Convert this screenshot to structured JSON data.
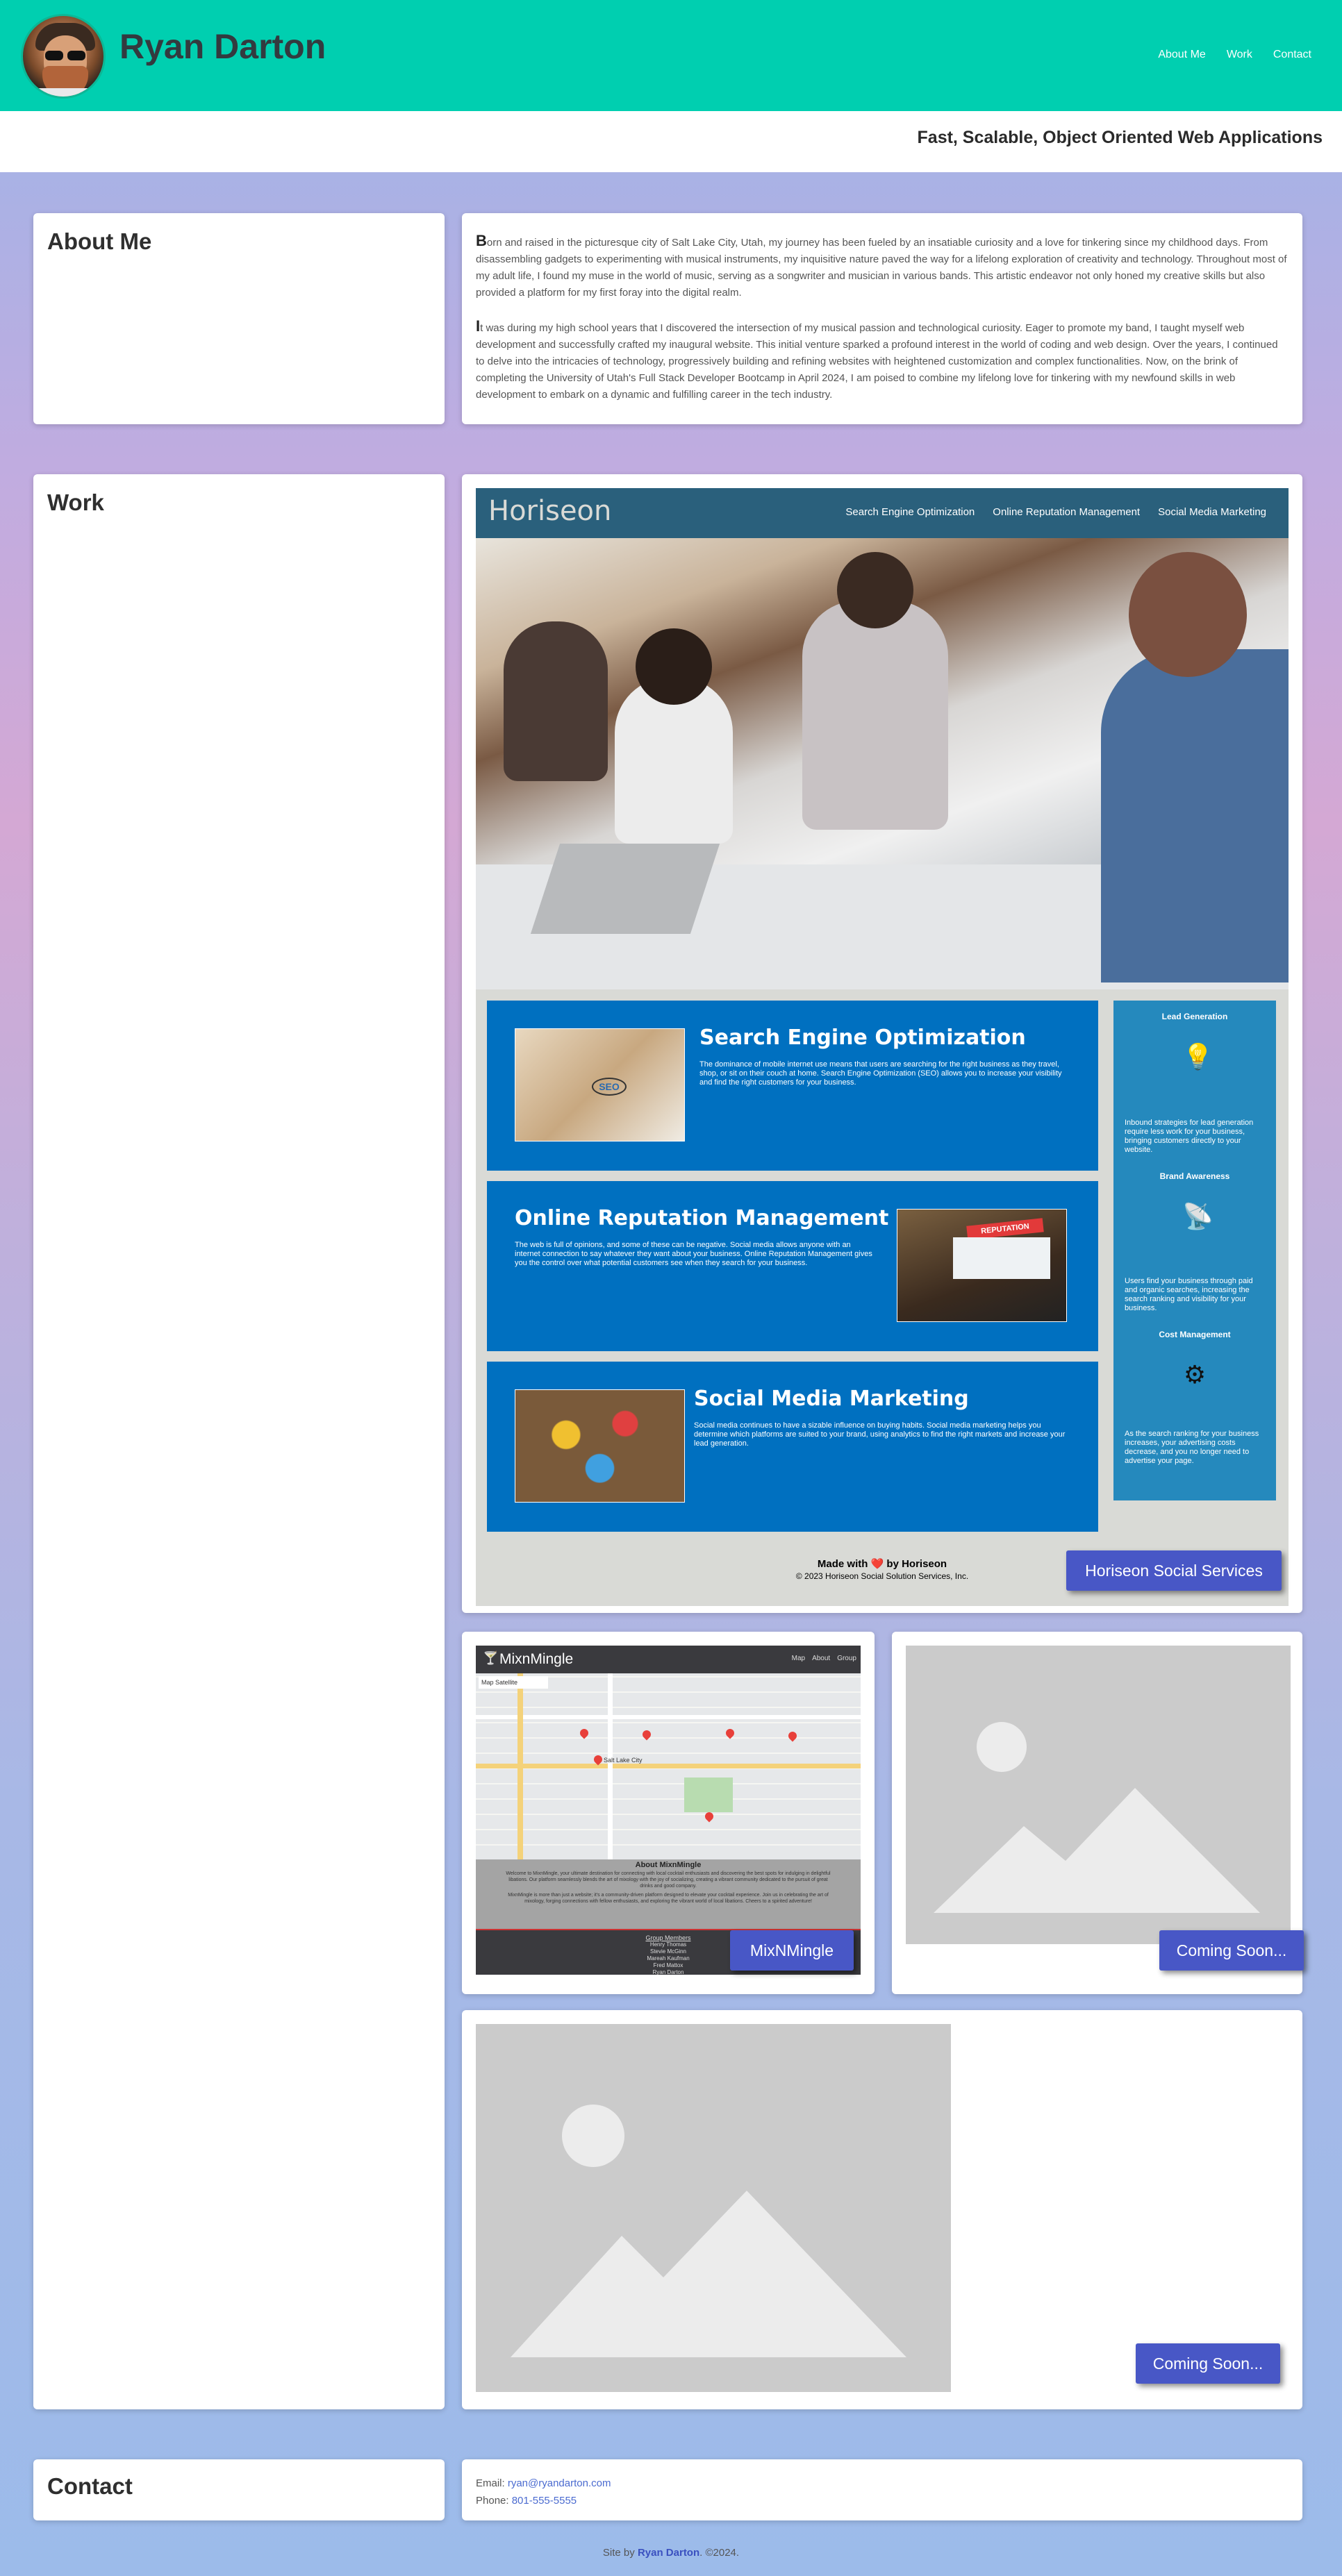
{
  "header": {
    "title": "Ryan Darton",
    "nav": [
      "About Me",
      "Work",
      "Contact"
    ],
    "tagline": "Fast, Scalable, Object Oriented Web Applications"
  },
  "about": {
    "title": "About Me",
    "paragraphs": [
      "Born and raised in the picturesque city of Salt Lake City, Utah, my journey has been fueled by an insatiable curiosity and a love for tinkering since my childhood days. From disassembling gadgets to experimenting with musical instruments, my inquisitive nature paved the way for a lifelong exploration of creativity and technology. Throughout most of my adult life, I found my muse in the world of music, serving as a songwriter and musician in various bands. This artistic endeavor not only honed my creative skills but also provided a platform for my first foray into the digital realm.",
      "It was during my high school years that I discovered the intersection of my musical passion and technological curiosity. Eager to promote my band, I taught myself web development and successfully crafted my inaugural website. This initial venture sparked a profound interest in the world of coding and web design. Over the years, I continued to delve into the intricacies of technology, progressively building and refining websites with heightened customization and complex functionalities. Now, on the brink of completing the University of Utah's Full Stack Developer Bootcamp in April 2024, I am poised to combine my lifelong love for tinkering with my newfound skills in web development to embark on a dynamic and fulfilling career in the tech industry."
    ]
  },
  "work": {
    "title": "Work",
    "horiseon": {
      "logo": "Horiseon",
      "nav": [
        "Search Engine Optimization",
        "Online Reputation Management",
        "Social Media Marketing"
      ],
      "blocks": [
        {
          "title": "Search Engine Optimization",
          "text": "The dominance of mobile internet use means that users are searching for the right business as they travel, shop, or sit on their couch at home. Search Engine Optimization (SEO) allows you to increase your visibility and find the right customers for your business."
        },
        {
          "title": "Online Reputation Management",
          "text": "The web is full of opinions, and some of these can be negative. Social media allows anyone with an internet connection to say whatever they want about your business. Online Reputation Management gives you the control over what potential customers see when they search for your business."
        },
        {
          "title": "Social Media Marketing",
          "text": "Social media continues to have a sizable influence on buying habits. Social media marketing helps you determine which platforms are suited to your brand, using analytics to find the right markets and increase your lead generation."
        }
      ],
      "benefits": [
        {
          "title": "Lead Generation",
          "text": "Inbound strategies for lead generation require less work for your business, bringing customers directly to your website."
        },
        {
          "title": "Brand Awareness",
          "text": "Users find your business through paid and organic searches, increasing the search ranking and visibility for your business."
        },
        {
          "title": "Cost Management",
          "text": "As the search ranking for your business increases, your advertising costs decrease, and you no longer need to advertise your page."
        }
      ],
      "footer_made": "Made with ❤️ by Horiseon",
      "footer_copy": "© 2023 Horiseon Social Solution Services, Inc.",
      "seo_badge": "SEO",
      "rep_badge": "REPUTATION",
      "button": "Horiseon Social Services"
    },
    "mixnmingle": {
      "logo": "MixnMingle",
      "nav": [
        "Map",
        "About",
        "Group"
      ],
      "map_tabs": "Map   Satellite",
      "map_city": "Salt Lake City",
      "about_title": "About MixnMingle",
      "about_text_1": "Welcome to MixnMingle, your ultimate destination for connecting with local cocktail enthusiasts and discovering the best spots for indulging in delightful libations. Our platform seamlessly blends the art of mixology with the joy of socializing, creating a vibrant community dedicated to the pursuit of great drinks and good company.",
      "about_text_2": "MixnMingle is more than just a website; it's a community-driven platform designed to elevate your cocktail experience. Join us in celebrating the art of mixology, forging connections with fellow enthusiasts, and exploring the vibrant world of local libations. Cheers to a spirited adventure!",
      "members_title": "Group Members",
      "members": [
        "Henry Thomas",
        "Stevie McGinn",
        "Mareah Kaufman",
        "Fred Mattox",
        "Ryan Darton"
      ],
      "button": "MixNMingle"
    },
    "coming_soon_1": "Coming Soon...",
    "coming_soon_2": "Coming Soon..."
  },
  "contact": {
    "title": "Contact",
    "email_label": "Email: ",
    "email": "ryan@ryandarton.com",
    "phone_label": "Phone: ",
    "phone": "801-555-5555"
  },
  "footer": {
    "prefix": "Site by ",
    "name": "Ryan Darton",
    "suffix": ". ©2024."
  },
  "colors": {
    "header": "#00cfb0",
    "button": "#4857c6",
    "horiseon_blue": "#0070c0",
    "horiseon_bar": "#2a607c"
  }
}
